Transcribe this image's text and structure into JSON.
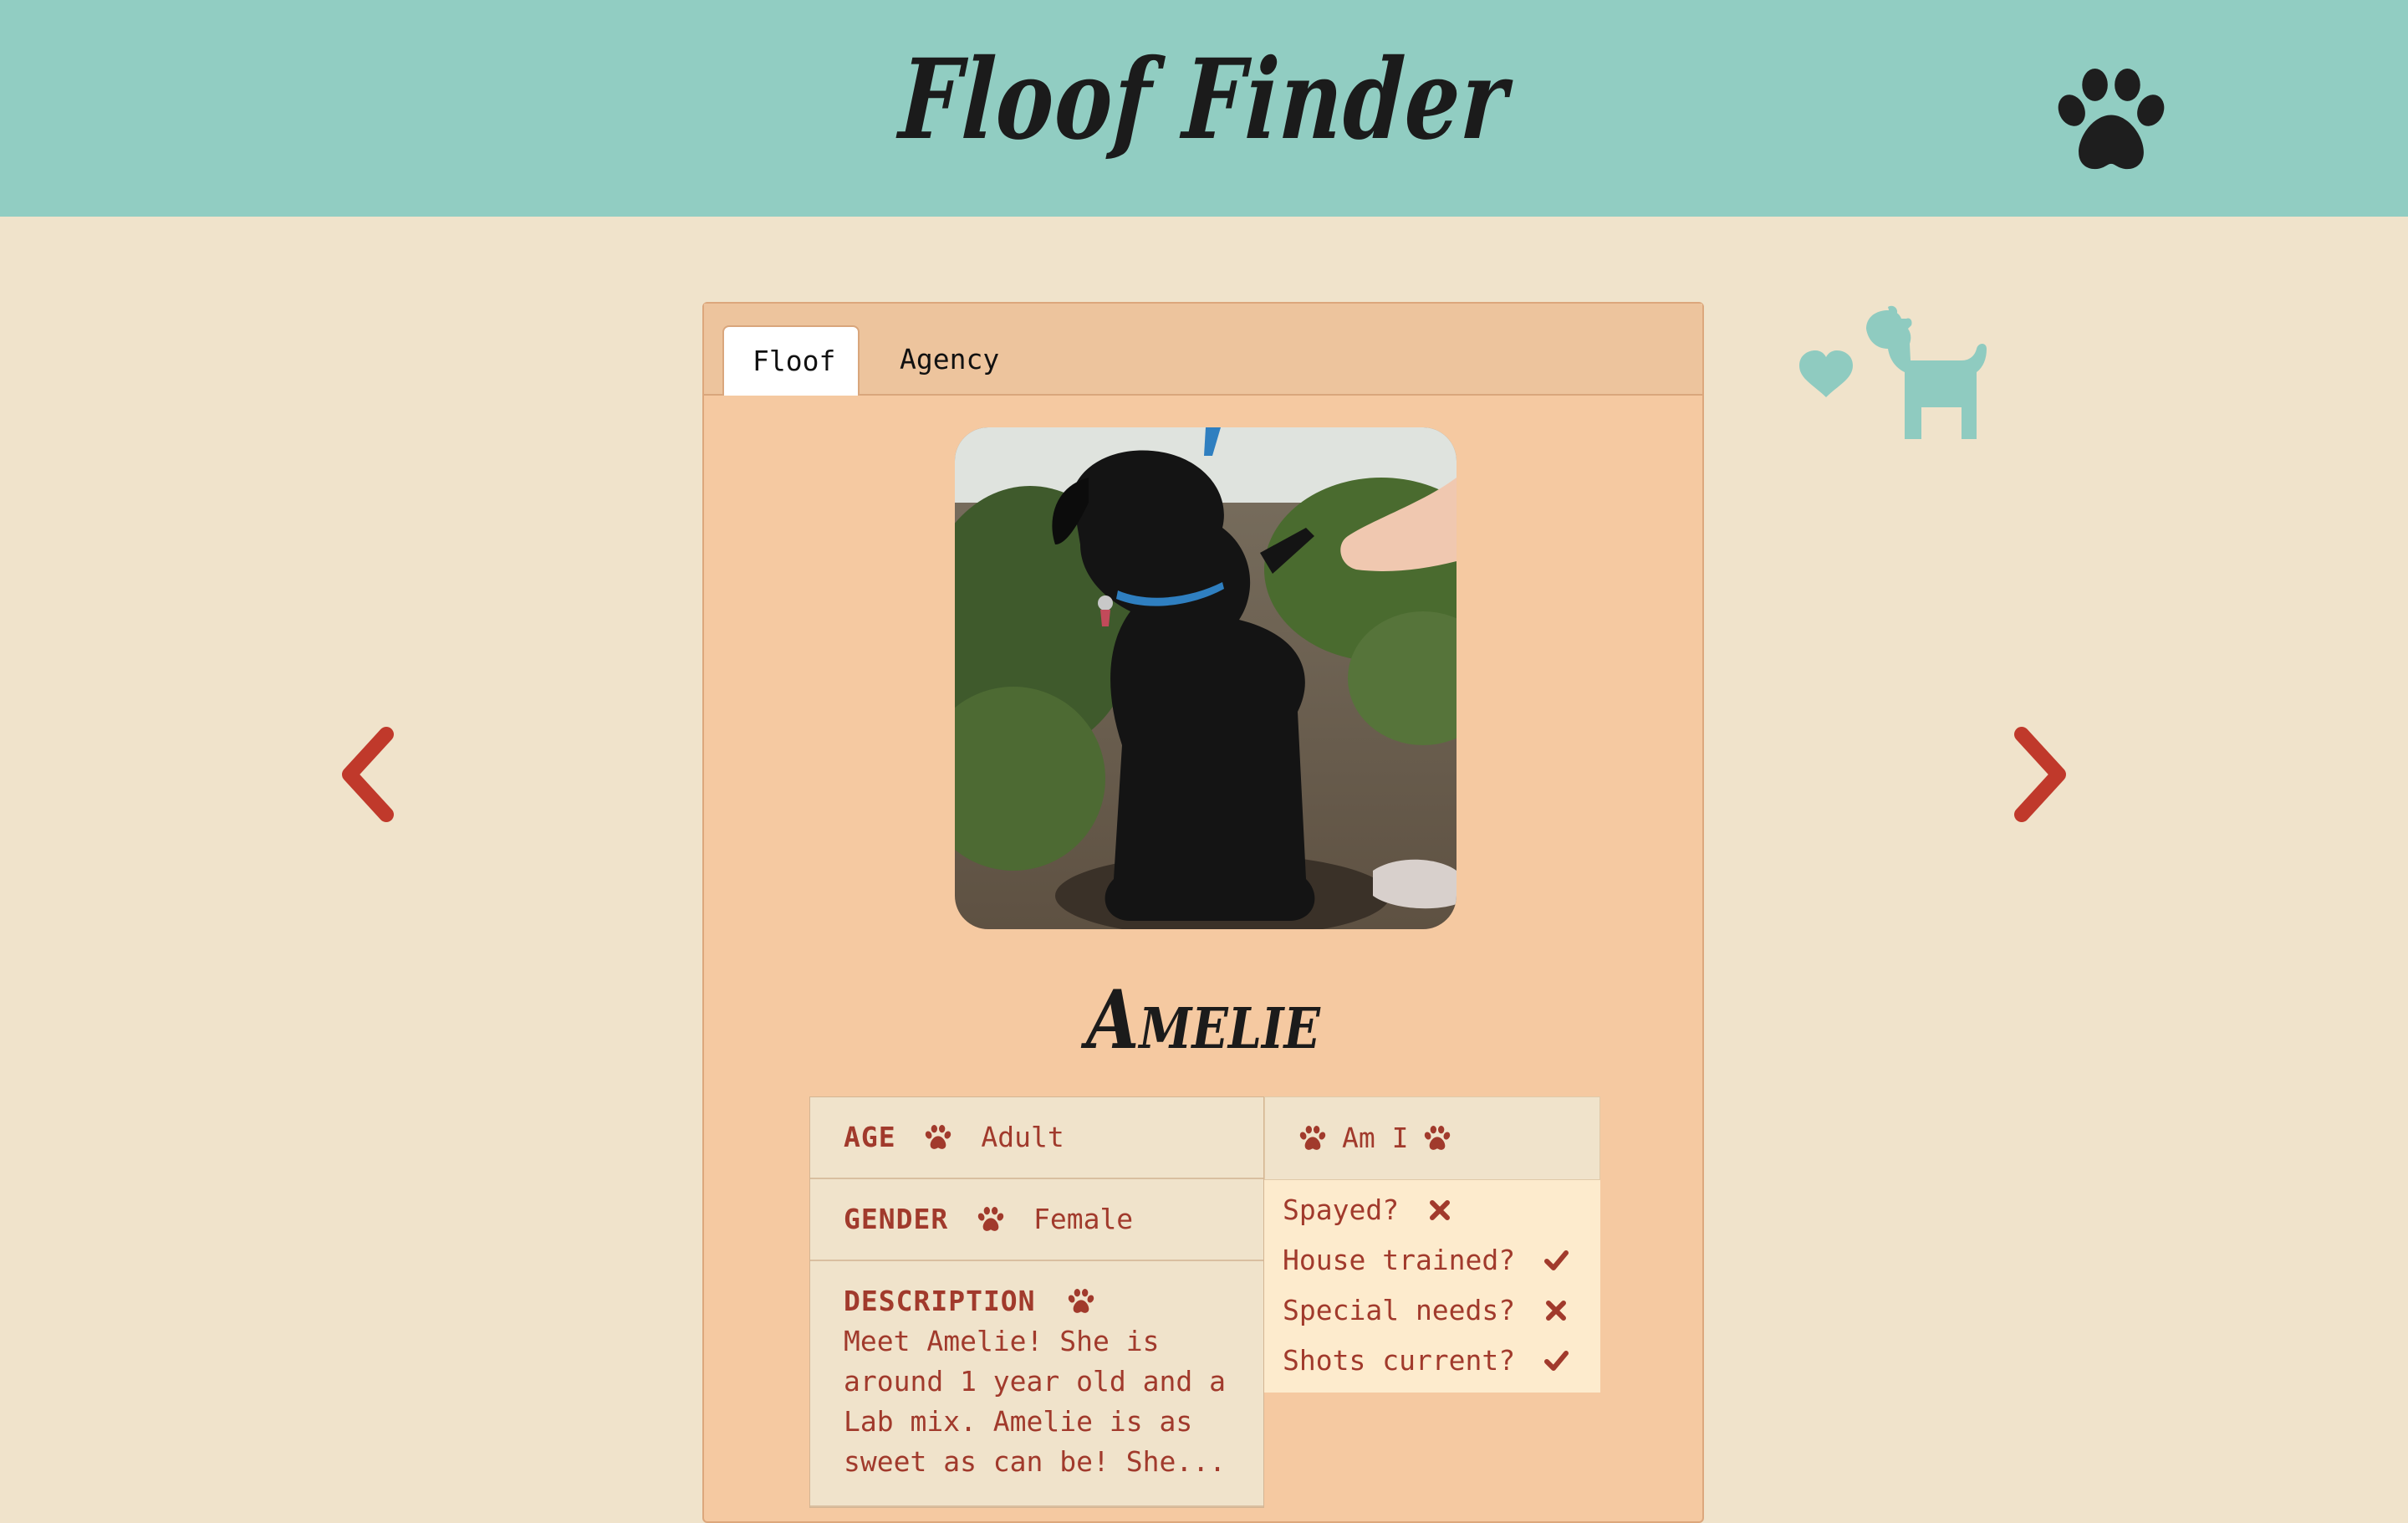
{
  "header": {
    "title": "Floof Finder",
    "icon": "paw-icon"
  },
  "tabs": [
    {
      "label": "Floof",
      "active": true
    },
    {
      "label": "Agency",
      "active": false
    }
  ],
  "floof": {
    "photo_alt": "Amelie",
    "name": "Amelie",
    "age_label": "AGE",
    "age_value": "Adult",
    "gender_label": "GENDER",
    "gender_value": "Female",
    "description_label": "DESCRIPTION",
    "description": "Meet Amelie! She is around 1 year old and a Lab mix. Amelie is as sweet as can be! She..."
  },
  "am_i": {
    "title": "Am I",
    "items": [
      {
        "label": "Spayed?",
        "value": false
      },
      {
        "label": "House trained?",
        "value": true
      },
      {
        "label": "Special needs?",
        "value": false
      },
      {
        "label": "Shots current?",
        "value": true
      }
    ]
  },
  "nav": {
    "prev_icon": "chevron-left-icon",
    "next_icon": "chevron-right-icon"
  },
  "colors": {
    "header_bg": "#91cdc2",
    "page_bg": "#f0e3cb",
    "card_bg": "#f5c9a1",
    "accent_red": "#c0392b",
    "text_red": "#a13a2c",
    "teal_icon": "#8fcbc0"
  }
}
